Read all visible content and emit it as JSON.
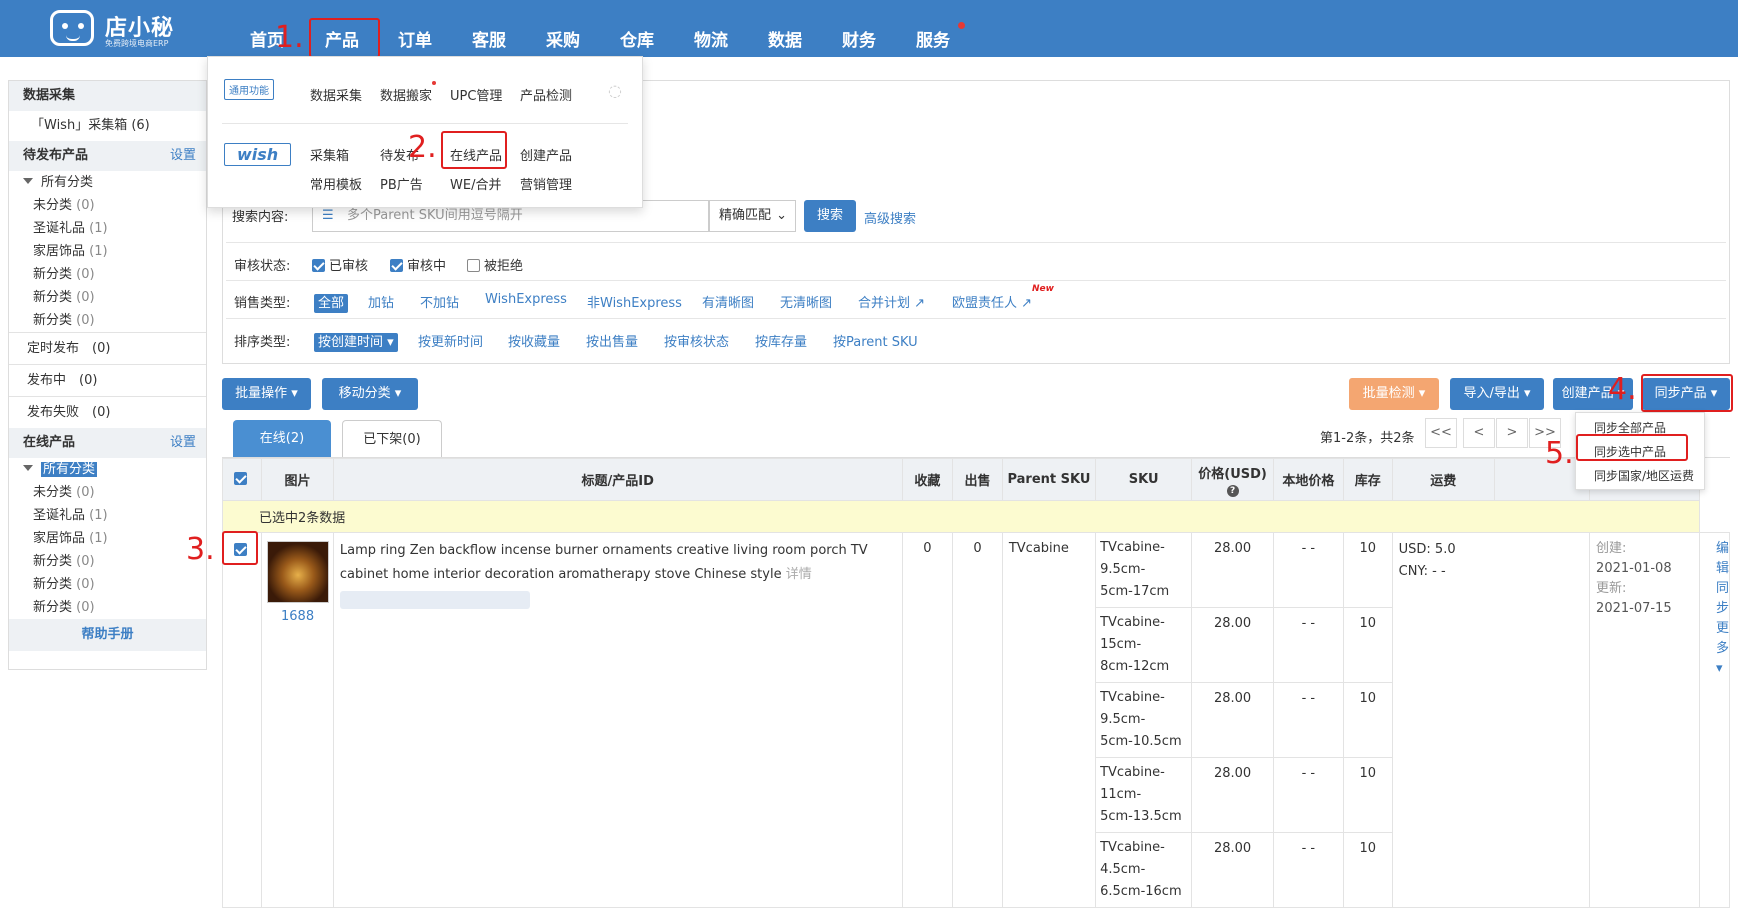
{
  "app": {
    "name": "店小秘",
    "subtitle": "免费跨境电商ERP"
  },
  "nav": [
    "首页",
    "产品",
    "订单",
    "客服",
    "采购",
    "仓库",
    "物流",
    "数据",
    "财务",
    "服务"
  ],
  "steps": [
    "1.",
    "2.",
    "3.",
    "4.",
    "5."
  ],
  "menu": {
    "tag_general": "通用功能",
    "general": [
      "数据采集",
      "数据搬家",
      "UPC管理",
      "产品检测"
    ],
    "platform": "wish",
    "wish_row1": [
      "采集箱",
      "待发布",
      "在线产品",
      "创建产品"
    ],
    "wish_row2": [
      "常用模板",
      "PB广告",
      "WE/合并",
      "营销管理"
    ]
  },
  "sidebar": {
    "collect_title": "数据采集",
    "collect_item": "「Wish」采集箱 (6)",
    "pending_title": "待发布产品",
    "set": "设置",
    "all_cat": "所有分类",
    "pending_cats": [
      {
        "n": "未分类",
        "c": "(0)"
      },
      {
        "n": "圣诞礼品",
        "c": "(1)"
      },
      {
        "n": "家居饰品",
        "c": "(1)"
      },
      {
        "n": "新分类",
        "c": "(0)"
      },
      {
        "n": "新分类",
        "c": "(0)"
      },
      {
        "n": "新分类",
        "c": "(0)"
      }
    ],
    "timed": "定时发布　(0)",
    "publishing": "发布中　(0)",
    "failed": "发布失败　(0)",
    "online_title": "在线产品",
    "online_cats": [
      {
        "n": "未分类",
        "c": "(0)"
      },
      {
        "n": "圣诞礼品",
        "c": "(1)"
      },
      {
        "n": "家居饰品",
        "c": "(1)"
      },
      {
        "n": "新分类",
        "c": "(0)"
      },
      {
        "n": "新分类",
        "c": "(0)"
      },
      {
        "n": "新分类",
        "c": "(0)"
      }
    ],
    "help": "帮助手册"
  },
  "filter": {
    "search_label": "搜索内容:",
    "search_placeholder": "多个Parent SKU间用逗号隔开",
    "match": "精确匹配",
    "search_btn": "搜索",
    "adv": "高级搜索",
    "review_label": "审核状态:",
    "review": [
      "已审核",
      "审核中",
      "被拒绝"
    ],
    "sale_label": "销售类型:",
    "sale": [
      "全部",
      "加钻",
      "不加钻",
      "WishExpress",
      "非WishExpress",
      "有清晰图",
      "无清晰图",
      "合并计划",
      "欧盟责任人"
    ],
    "new": "New",
    "sort_label": "排序类型:",
    "sort": [
      "按创建时间",
      "按更新时间",
      "按收藏量",
      "按出售量",
      "按审核状态",
      "按库存量",
      "按Parent SKU"
    ]
  },
  "toolbar": {
    "batch": "批量操作",
    "move": "移动分类",
    "check": "批量检测",
    "io": "导入/导出",
    "create": "创建产品",
    "sync": "同步产品"
  },
  "sync_menu": [
    "同步全部产品",
    "同步选中产品",
    "同步国家/地区运费"
  ],
  "tabs": [
    "在线(2)",
    "已下架(0)"
  ],
  "pagination": {
    "info": "第1-2条，共2条",
    "btns": [
      "<<",
      "<",
      ">",
      ">>"
    ]
  },
  "table": {
    "headers": [
      "图片",
      "标题/产品ID",
      "收藏",
      "出售",
      "Parent SKU",
      "SKU",
      "价格(USD)",
      "本地价格",
      "库存",
      "运费"
    ],
    "selected_note": "已选中2条数据",
    "row": {
      "title": "Lamp ring Zen backflow incense burner ornaments creative living room porch TV cabinet home interior decoration aromatherapy stove Chinese style",
      "detail": "详情",
      "source": "1688",
      "fav": "0",
      "sold": "0",
      "parent": "TVcabine",
      "shipping_usd": "USD:  5.0",
      "shipping_cny": "CNY:  - -",
      "created_label": "创建:",
      "created": "2021-01-08",
      "updated_label": "更新:",
      "updated": "2021-07-15",
      "actions": [
        "编辑",
        "同步",
        "更多"
      ],
      "variants": [
        {
          "sku1": "TVcabine-9.5cm-",
          "sku2": "5cm-17cm",
          "price": "28.00",
          "local": "- -",
          "stock": "10"
        },
        {
          "sku1": "TVcabine-15cm-",
          "sku2": "8cm-12cm",
          "price": "28.00",
          "local": "- -",
          "stock": "10"
        },
        {
          "sku1": "TVcabine-9.5cm-",
          "sku2": "5cm-10.5cm",
          "price": "28.00",
          "local": "- -",
          "stock": "10"
        },
        {
          "sku1": "TVcabine-11cm-",
          "sku2": "5cm-13.5cm",
          "price": "28.00",
          "local": "- -",
          "stock": "10"
        },
        {
          "sku1": "TVcabine-4.5cm-",
          "sku2": "6.5cm-16cm",
          "price": "28.00",
          "local": "- -",
          "stock": "10"
        }
      ]
    }
  }
}
